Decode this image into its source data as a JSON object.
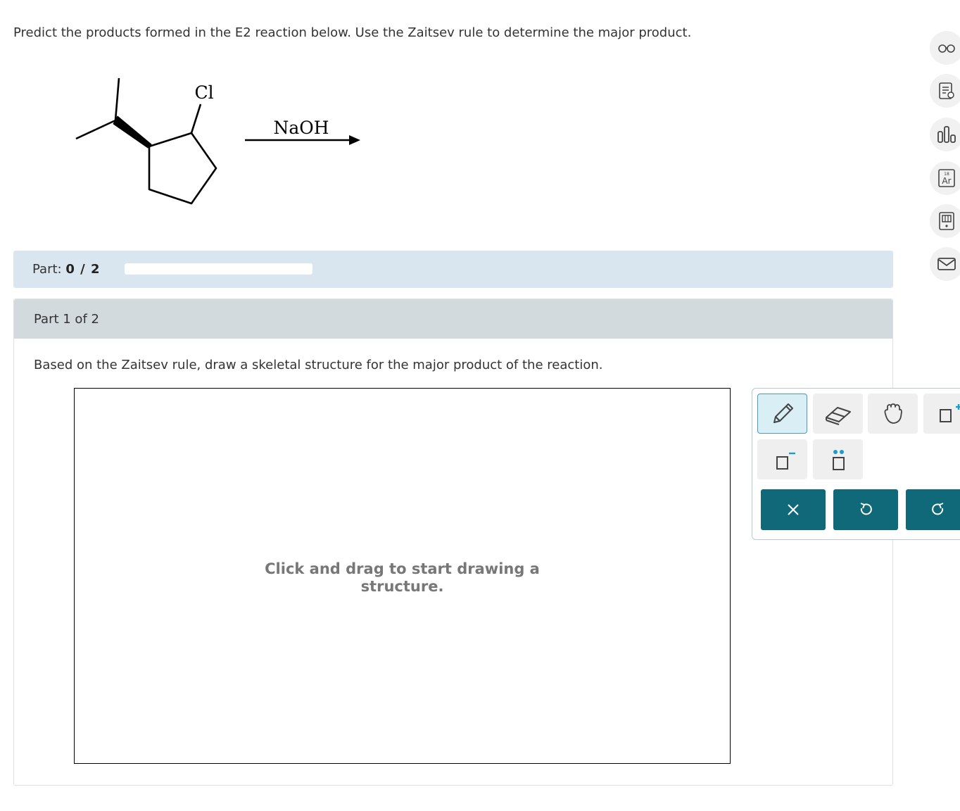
{
  "question": {
    "text": "Predict the products formed in the E2 reaction below. Use the Zaitsev rule to determine the major product."
  },
  "reaction": {
    "substituent_label": "Cl",
    "reagent_label": "NaOH"
  },
  "side_toolbar": {
    "icons": [
      "glasses-icon",
      "notes-icon",
      "chart-icon",
      "periodic-table-icon",
      "calculator-icon",
      "mail-icon"
    ],
    "periodic_number": "18",
    "periodic_symbol": "Ar"
  },
  "progress": {
    "label": "Part:",
    "value": "0 / 2",
    "fraction": 0
  },
  "part": {
    "header": "Part 1 of 2",
    "instruction": "Based on the Zaitsev rule, draw a skeletal structure for the major product of the reaction.",
    "canvas_hint_line1": "Click and drag to start drawing a",
    "canvas_hint_line2": "structure."
  },
  "drawing_tools": {
    "tools": [
      "pencil-icon",
      "eraser-icon",
      "hand-icon",
      "add-charge-icon",
      "negative-charge-icon",
      "lone-pair-icon"
    ],
    "actions": [
      "clear-icon",
      "undo-icon",
      "redo-icon"
    ]
  },
  "colors": {
    "accent": "#0f6979",
    "progress_bar": "#dae6ef",
    "part_header": "#d3dadd",
    "lone_pair": "#1aa0c8"
  }
}
